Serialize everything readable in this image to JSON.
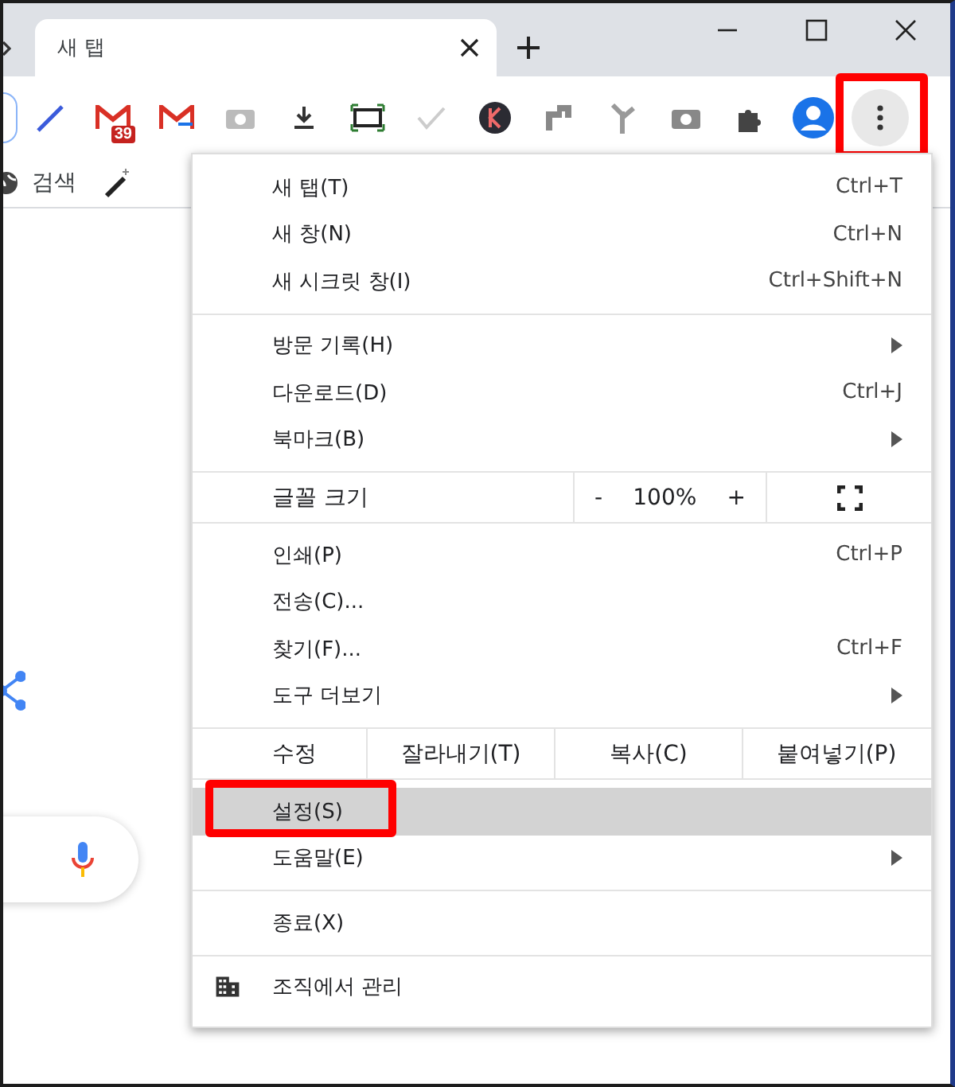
{
  "tab": {
    "title": "새 탭",
    "selected": true
  },
  "toolbar": {
    "mail_badge": "39",
    "menu_button": {
      "annotated": true
    }
  },
  "bookmarks": [
    {
      "label": "검색"
    }
  ],
  "menu": {
    "sections": [
      {
        "kind": "items",
        "items": [
          {
            "label": "새 탭(T)",
            "shortcut": "Ctrl+T",
            "submenu": false,
            "selected": false,
            "annotated": false,
            "kind": "command"
          },
          {
            "label": "새 창(N)",
            "shortcut": "Ctrl+N",
            "submenu": false,
            "selected": false,
            "annotated": false,
            "kind": "command"
          },
          {
            "label": "새 시크릿 창(I)",
            "shortcut": "Ctrl+Shift+N",
            "submenu": false,
            "selected": false,
            "annotated": false,
            "kind": "command"
          }
        ]
      },
      {
        "kind": "items",
        "items": [
          {
            "label": "방문 기록(H)",
            "submenu": true,
            "selected": false,
            "annotated": false,
            "kind": "command"
          },
          {
            "label": "다운로드(D)",
            "shortcut": "Ctrl+J",
            "submenu": false,
            "selected": false,
            "annotated": false,
            "kind": "command"
          },
          {
            "label": "북마크(B)",
            "submenu": true,
            "selected": false,
            "annotated": false,
            "kind": "command"
          }
        ]
      },
      {
        "kind": "zoom",
        "label": "글꼴 크기",
        "minus": "-",
        "value": "100%",
        "plus": "+"
      },
      {
        "kind": "items",
        "items": [
          {
            "label": "인쇄(P)",
            "shortcut": "Ctrl+P",
            "submenu": false,
            "selected": false,
            "annotated": false,
            "kind": "command"
          },
          {
            "label": "전송(C)...",
            "submenu": false,
            "selected": false,
            "annotated": false,
            "kind": "command"
          },
          {
            "label": "찾기(F)...",
            "shortcut": "Ctrl+F",
            "submenu": false,
            "selected": false,
            "annotated": false,
            "kind": "command"
          },
          {
            "label": "도구 더보기",
            "submenu": true,
            "selected": false,
            "annotated": false,
            "kind": "command"
          }
        ]
      },
      {
        "kind": "edit",
        "label": "수정",
        "buttons": [
          "잘라내기(T)",
          "복사(C)",
          "붙여넣기(P)"
        ]
      },
      {
        "kind": "items",
        "items": [
          {
            "label": "설정(S)",
            "submenu": false,
            "selected": true,
            "annotated": true,
            "kind": "command"
          },
          {
            "label": "도움말(E)",
            "submenu": true,
            "selected": false,
            "annotated": false,
            "kind": "command"
          }
        ]
      },
      {
        "kind": "items",
        "items": [
          {
            "label": "종료(X)",
            "submenu": false,
            "selected": false,
            "annotated": false,
            "kind": "command"
          }
        ]
      },
      {
        "kind": "items",
        "items": [
          {
            "label": "조직에서 관리",
            "submenu": false,
            "selected": false,
            "annotated": false,
            "kind": "managed"
          }
        ]
      }
    ]
  }
}
